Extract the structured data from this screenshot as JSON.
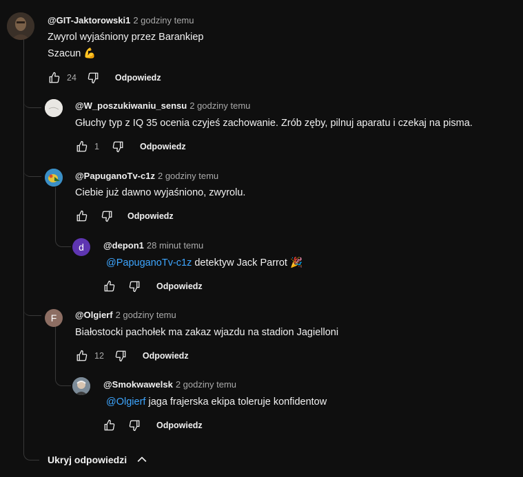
{
  "comments": {
    "c1": {
      "author": "@GIT-Jaktorowski1",
      "time": "2 godziny temu",
      "line1": "Zwyrol wyjaśniony przez Barankiep",
      "line2": "Szacun 💪",
      "likes": "24",
      "reply": "Odpowiedz"
    },
    "c2": {
      "author": "@W_poszukiwaniu_sensu",
      "time": "2 godziny temu",
      "text": "Głuchy typ z IQ 35 ocenia czyjeś zachowanie. Zrób zęby, pilnuj aparatu i czekaj na pisma.",
      "likes": "1",
      "reply": "Odpowiedz"
    },
    "c3": {
      "author": "@PapuganoTv-c1z",
      "time": "2 godziny temu",
      "text": "Ciebie już dawno wyjaśniono, zwyrolu.",
      "reply": "Odpowiedz"
    },
    "c4": {
      "author": "@depon1",
      "time": "28 minut temu",
      "avatar_letter": "d",
      "mention": "@PapuganoTv-c1z",
      "text": " detektyw Jack Parrot 🎉",
      "reply": "Odpowiedz"
    },
    "c5": {
      "author": "@Olgierf",
      "time": "2 godziny temu",
      "avatar_letter": "F",
      "text": "Białostocki pachołek ma zakaz wjazdu na stadion Jagielloni",
      "likes": "12",
      "reply": "Odpowiedz"
    },
    "c6": {
      "author": "@Smokwawelsk",
      "time": "2 godziny temu",
      "mention": "@Olgierf",
      "text": " jaga frajerska ekipa toleruje konfidentow",
      "reply": "Odpowiedz"
    }
  },
  "hide_replies": "Ukryj odpowiedzi",
  "colors": {
    "bg": "#0f0f0f",
    "mention": "#3ea6ff",
    "depon_avatar": "#5e35b1",
    "olgierf_avatar": "#8d6e63"
  },
  "icons": {
    "like": "thumb-up-icon",
    "dislike": "thumb-down-icon",
    "collapse": "chevron-up-icon"
  }
}
